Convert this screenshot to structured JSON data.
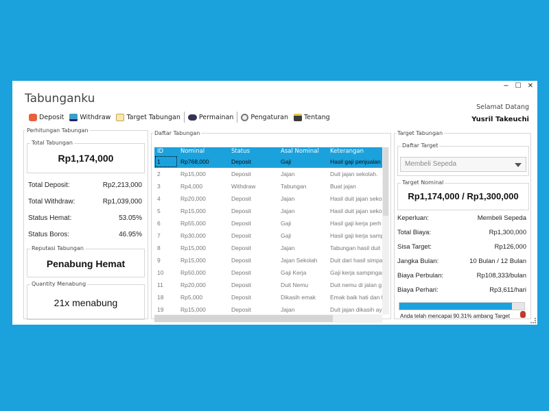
{
  "app": {
    "title": "Tabunganku"
  },
  "window_controls": {
    "minimize": "−",
    "maximize": "☐",
    "close": "✕"
  },
  "header": {
    "welcome": "Selamat Datang",
    "username": "Yusril Takeuchi"
  },
  "toolbar": [
    {
      "label": "Deposit",
      "icon": "deposit-icon"
    },
    {
      "label": "Withdraw",
      "icon": "withdraw-icon"
    },
    {
      "label": "Target Tabungan",
      "icon": "target-icon"
    },
    {
      "label": "Permainan",
      "icon": "game-icon"
    },
    {
      "label": "Pengaturan",
      "icon": "gear-icon"
    },
    {
      "label": "Tentang",
      "icon": "about-icon"
    }
  ],
  "left": {
    "legend": "Perhitungan Tabungan",
    "total_label": "Total Tabungan",
    "total_value": "Rp1,174,000",
    "stats": [
      {
        "label": "Total Deposit:",
        "value": "Rp2,213,000"
      },
      {
        "label": "Total Withdraw:",
        "value": "Rp1,039,000"
      },
      {
        "label": "Status Hemat:",
        "value": "53.05%"
      },
      {
        "label": "Status Boros:",
        "value": "46.95%"
      }
    ],
    "reputation_label": "Reputasi Tabungan",
    "reputation_value": "Penabung Hemat",
    "quantity_label": "Quantity Menabung",
    "quantity_value": "21x menabung"
  },
  "center": {
    "legend": "Daftar Tabungan",
    "columns": [
      "ID",
      "Nominal",
      "Status",
      "Asal Nominal",
      "Keterangan"
    ],
    "rows": [
      [
        "1",
        "Rp768,000",
        "Deposit",
        "Gaji",
        "Hasil gaji penjualan"
      ],
      [
        "2",
        "Rp15,000",
        "Deposit",
        "Jajan",
        "Duit jajan sekolah."
      ],
      [
        "3",
        "Rp4,000",
        "Withdraw",
        "Tabungan",
        "Buat jajan"
      ],
      [
        "4",
        "Rp20,000",
        "Deposit",
        "Jajan",
        "Hasil duit jajan seko"
      ],
      [
        "5",
        "Rp15,000",
        "Deposit",
        "Jajan",
        "Hasil duit jajan seko"
      ],
      [
        "6",
        "Rp55,000",
        "Deposit",
        "Gaji",
        "Hasil gaji kerja perh"
      ],
      [
        "7",
        "Rp30,000",
        "Deposit",
        "Gaji",
        "Hasil gaji kerja samp"
      ],
      [
        "8",
        "Rp15,000",
        "Deposit",
        "Jajan",
        "Tabungan hasil duit"
      ],
      [
        "9",
        "Rp15,000",
        "Deposit",
        "Jajan Sekolah",
        "Duit dari hasil simpa"
      ],
      [
        "10",
        "Rp50,000",
        "Deposit",
        "Gaji Kerja",
        "Gaji kerja sampingar"
      ],
      [
        "11",
        "Rp20,000",
        "Deposit",
        "Duit Nemu",
        "Duit nemu di jalan g"
      ],
      [
        "18",
        "Rp5,000",
        "Deposit",
        "Dikasih emak",
        "Emak baik hati dan f"
      ],
      [
        "19",
        "Rp15,000",
        "Deposit",
        "Jajan",
        "Duit jajan dikasih ay"
      ]
    ]
  },
  "right": {
    "legend": "Target Tabungan",
    "list_label": "Daftar Target",
    "selected_target": "Membeli Sepeda",
    "nominal_label": "Target Nominal",
    "nominal_value": "Rp1,174,000 / Rp1,300,000",
    "details": [
      {
        "label": "Keperluan:",
        "value": "Membeli Sepeda"
      },
      {
        "label": "Total Biaya:",
        "value": "Rp1,300,000"
      },
      {
        "label": "Sisa Target:",
        "value": "Rp126,000"
      },
      {
        "label": "Jangka Bulan:",
        "value": "10 Bulan / 12 Bulan"
      },
      {
        "label": "Biaya Perbulan:",
        "value": "Rp108,333/bulan"
      },
      {
        "label": "Biaya Perhari:",
        "value": "Rp3,611/hari"
      }
    ],
    "progress_fraction": 0.9031,
    "progress_text": "Anda telah mencapai 90.31% ambang Target"
  },
  "colors": {
    "accent": "#1BA1DC",
    "background": "#1BA1DC",
    "window": "#FFFFFF"
  }
}
